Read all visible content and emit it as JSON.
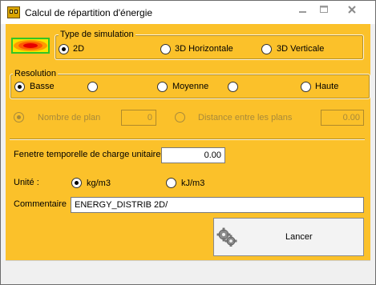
{
  "window": {
    "title": "Calcul de répartition d'énergie",
    "controls": {
      "minimize": "minimize-icon",
      "maximize": "maximize-icon",
      "close": "close-icon"
    }
  },
  "simulation": {
    "group_label": "Type de simulation",
    "options": [
      "2D",
      "3D Horizontale",
      "3D Verticale"
    ],
    "selected": "2D"
  },
  "resolution": {
    "group_label": "Resolution",
    "options": [
      "Basse",
      "",
      "Moyenne",
      "",
      "Haute"
    ],
    "selected": "Basse"
  },
  "plans": {
    "nombre_label": "Nombre de plan",
    "nombre_value": "0",
    "distance_label": "Distance entre les plans",
    "distance_value": "0.00"
  },
  "fenetre": {
    "label": "Fenetre temporelle de charge unitaire",
    "value": "0.00"
  },
  "unite": {
    "label": "Unité :",
    "options": [
      "kg/m3",
      "kJ/m3"
    ],
    "selected": "kg/m3"
  },
  "commentaire": {
    "label": "Commentaire",
    "value": "ENERGY_DISTRIB 2D/"
  },
  "lancer_button": {
    "label": "Lancer",
    "icon": "gears-icon"
  },
  "colors": {
    "panel": "#fbc12a",
    "preview_border": "#34c424"
  }
}
